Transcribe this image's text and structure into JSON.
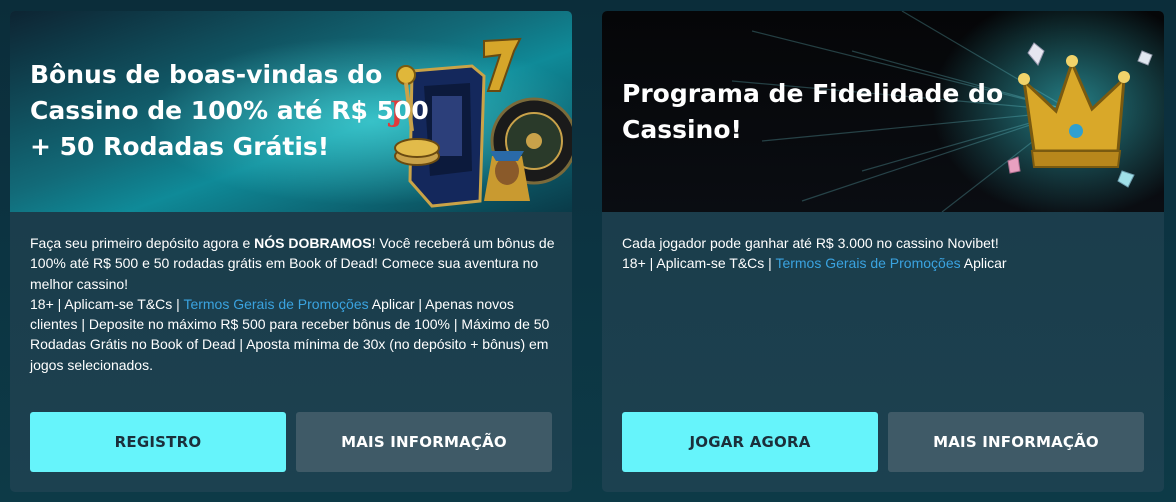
{
  "cards": [
    {
      "title": "Bônus de boas-vindas do Cassino de 100% até R$ 500 + 50 Rodadas Grátis!",
      "desc": {
        "p1_pre": "Faça seu primeiro depósito agora e ",
        "p1_bold": "NÓS DOBRAMOS",
        "p1_post": "! Você receberá um bônus de 100% até R$ 500 e 50 rodadas grátis em Book of Dead! Comece sua aventura no melhor cassino!",
        "terms_pre": "18+ | Aplicam-se T&Cs | ",
        "terms_link": "Termos Gerais de Promoções",
        "terms_post": " Aplicar | Apenas novos clientes | Deposite no máximo R$ 500 para receber bônus de 100% | Máximo de 50 Rodadas Grátis no Book of Dead | Aposta mínima de 30x (no depósito + bônus) em jogos selecionados."
      },
      "primary_button": "REGISTRO",
      "secondary_button": "MAIS INFORMAÇÃO",
      "banner_icon": "slot-machine-icon"
    },
    {
      "title": "Programa de Fidelidade do Cassino!",
      "desc": {
        "p1": "Cada jogador pode ganhar até R$ 3.000 no cassino Novibet!",
        "terms_pre": "18+ | Aplicam-se T&Cs | ",
        "terms_link": "Termos Gerais de Promoções",
        "terms_post": " Aplicar"
      },
      "primary_button": "JOGAR AGORA",
      "secondary_button": "MAIS INFORMAÇÃO",
      "banner_icon": "crown-icon"
    }
  ],
  "colors": {
    "primary_button": "#66f4fb",
    "secondary_button": "#3f5a67",
    "link": "#3aa3e0"
  }
}
